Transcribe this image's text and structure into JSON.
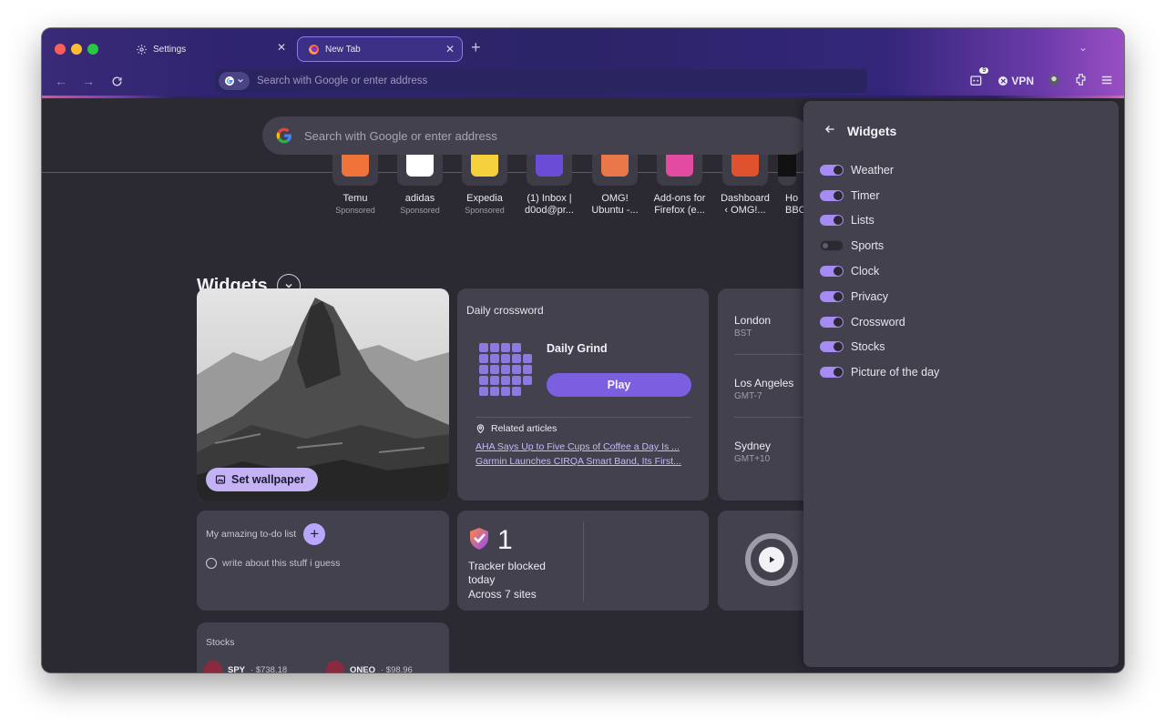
{
  "colors": {
    "accent": "#a58bf2",
    "tab_active_border": "#8d7cf0",
    "play_button": "#7b5fe0",
    "link": "#c9b7ff",
    "content_bg": "#2b2a33",
    "card_bg": "#42414d"
  },
  "tabs": [
    {
      "label": "Settings",
      "icon": "gear-icon"
    },
    {
      "label": "New Tab",
      "icon": "firefox-icon",
      "active": true
    }
  ],
  "toolbar": {
    "url_placeholder": "Search with Google or enter address",
    "badge_count": "9",
    "vpn_label": "VPN"
  },
  "newtab": {
    "search_placeholder": "Search with Google or enter address",
    "shortcuts": [
      {
        "title": "Temu",
        "sub": "Sponsored",
        "color": "#f0743a"
      },
      {
        "title": "adidas",
        "sub": "Sponsored",
        "color": "#ffffff"
      },
      {
        "title": "Expedia",
        "sub": "Sponsored",
        "color": "#f5d23d"
      },
      {
        "title": "(1) Inbox |",
        "title2": "d0od@pr...",
        "sub": "",
        "color": "#6a4cd6"
      },
      {
        "title": "OMG!",
        "title2": "Ubuntu -...",
        "sub": "",
        "color": "#e9774a"
      },
      {
        "title": "Add-ons for",
        "title2": "Firefox (e...",
        "sub": "",
        "color": "#e34ba0"
      },
      {
        "title": "Dashboard",
        "title2": "‹ OMG!...",
        "sub": "",
        "color": "#e0522e"
      },
      {
        "title": "Ho",
        "title2": "BBC",
        "sub": "",
        "color": "#111111"
      }
    ]
  },
  "widgets": {
    "heading": "Widgets",
    "wallpaper": {
      "button_label": "Set wallpaper"
    },
    "crossword": {
      "title": "Daily crossword",
      "name": "Daily Grind",
      "play_label": "Play",
      "related_label": "Related articles",
      "links": [
        "AHA Says Up to Five Cups of Coffee a Day Is ...",
        "Garmin Launches CIRQA Smart Band, Its First..."
      ]
    },
    "clock": {
      "cities": [
        {
          "city": "London",
          "tz": "BST"
        },
        {
          "city": "Los Angeles",
          "tz": "GMT-7"
        },
        {
          "city": "Sydney",
          "tz": "GMT+10"
        }
      ]
    },
    "todo": {
      "title": "My amazing to-do list",
      "items": [
        "write about this stuff i guess"
      ]
    },
    "privacy": {
      "count": "1",
      "line1": "Tracker blocked",
      "line2": "today",
      "line3": "Across 7 sites"
    },
    "stocks": {
      "title": "Stocks",
      "items": [
        {
          "ticker": "SPY",
          "price": "· $738.18"
        },
        {
          "ticker": "ONEQ",
          "price": "· $98.96"
        }
      ]
    }
  },
  "panel": {
    "title": "Widgets",
    "items": [
      {
        "label": "Weather",
        "on": true
      },
      {
        "label": "Timer",
        "on": true
      },
      {
        "label": "Lists",
        "on": true
      },
      {
        "label": "Sports",
        "on": false
      },
      {
        "label": "Clock",
        "on": true
      },
      {
        "label": "Privacy",
        "on": true
      },
      {
        "label": "Crossword",
        "on": true
      },
      {
        "label": "Stocks",
        "on": true
      },
      {
        "label": "Picture of the day",
        "on": true
      }
    ]
  }
}
